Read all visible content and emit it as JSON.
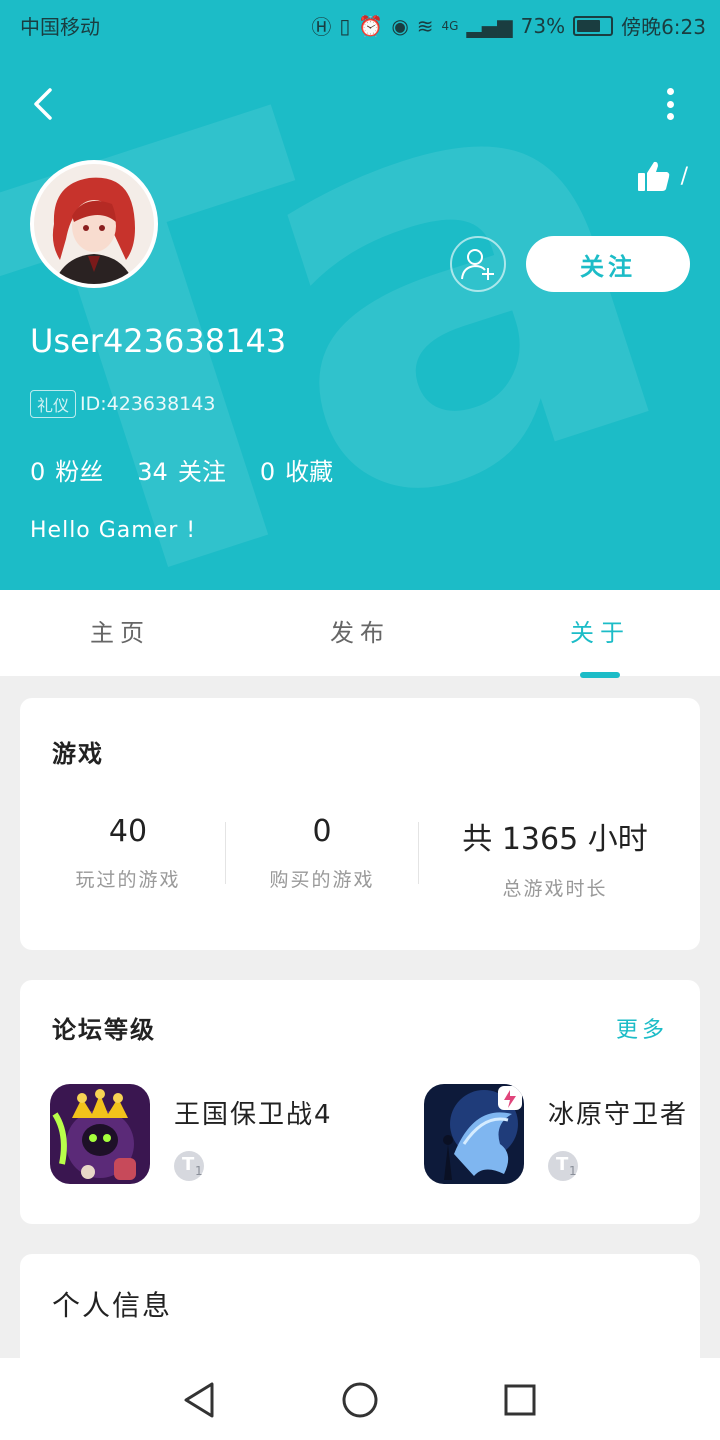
{
  "status_bar": {
    "carrier": "中国移动",
    "battery": "73%",
    "battery_level": 0.73,
    "time": "傍晚6:23",
    "network": "4G"
  },
  "profile": {
    "username": "User423638143",
    "badge": "礼仪",
    "id_text": "ID:423638143",
    "like_count": "/",
    "follow_label": "关注",
    "stats": [
      {
        "num": "0",
        "label": "粉丝"
      },
      {
        "num": "34",
        "label": "关注"
      },
      {
        "num": "0",
        "label": "收藏"
      }
    ],
    "bio": "Hello Gamer !"
  },
  "tabs": [
    {
      "label": "主页",
      "active": false
    },
    {
      "label": "发布",
      "active": false
    },
    {
      "label": "关于",
      "active": true
    }
  ],
  "games_card": {
    "title": "游戏",
    "stats": [
      {
        "value": "40",
        "label": "玩过的游戏"
      },
      {
        "value": "0",
        "label": "购买的游戏"
      },
      {
        "value": "共 1365 小时",
        "label": "总游戏时长"
      }
    ]
  },
  "forum_card": {
    "title": "论坛等级",
    "more": "更多",
    "items": [
      {
        "name": "王国保卫战4",
        "level": "1",
        "icon": "kingdom-rush-icon"
      },
      {
        "name": "冰原守卫者",
        "level": "1",
        "icon": "ice-guardian-icon"
      }
    ]
  },
  "info_card": {
    "title": "个人信息"
  },
  "colors": {
    "accent": "#1cbcc7",
    "background": "#efefef"
  }
}
